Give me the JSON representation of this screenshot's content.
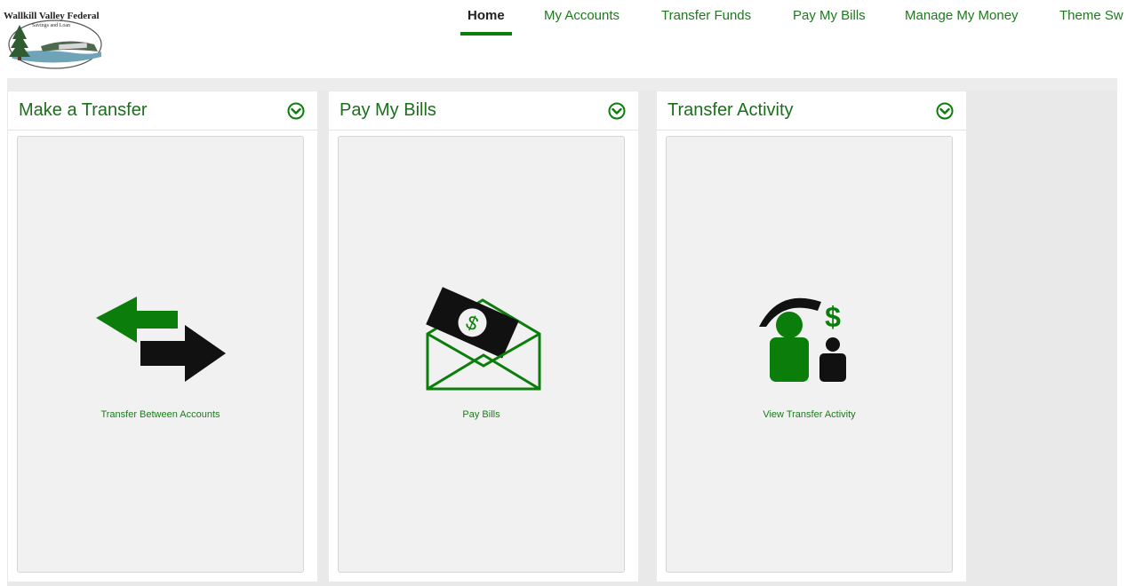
{
  "header": {
    "logo": {
      "name": "Wallkill Valley Federal",
      "subtitle": "Savings and Loan"
    },
    "nav": [
      {
        "label": "Home",
        "active": true
      },
      {
        "label": "My Accounts",
        "active": false
      },
      {
        "label": "Transfer Funds",
        "active": false
      },
      {
        "label": "Pay My Bills",
        "active": false
      },
      {
        "label": "Manage My Money",
        "active": false
      },
      {
        "label": "Theme Sw",
        "active": false
      }
    ]
  },
  "cards": [
    {
      "title": "Make a Transfer",
      "icon": "transfer-arrows-icon",
      "link_label": "Transfer Between Accounts"
    },
    {
      "title": "Pay My Bills",
      "icon": "envelope-dollar-icon",
      "link_label": "Pay Bills"
    },
    {
      "title": "Transfer Activity",
      "icon": "people-dollar-icon",
      "link_label": "View Transfer Activity"
    }
  ],
  "colors": {
    "accent": "#0a7d0a",
    "nav_text": "#1c7a1c",
    "title_text": "#1c6e1c",
    "band_bg": "#e9e9e9",
    "card_body_bg": "#f1f1f1"
  }
}
